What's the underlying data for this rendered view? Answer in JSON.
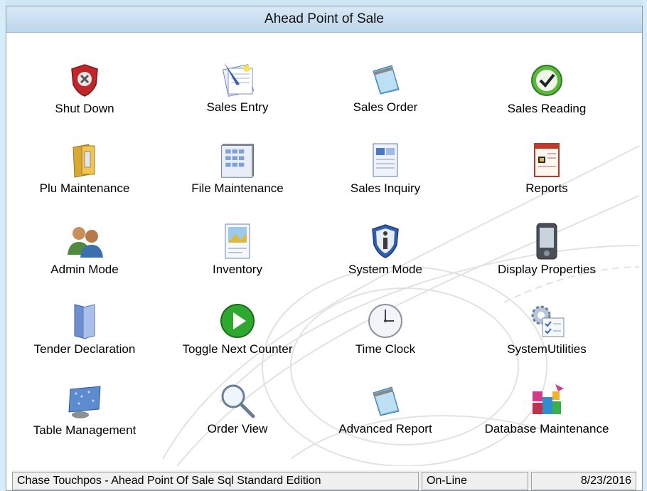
{
  "window": {
    "title": "Ahead Point of Sale"
  },
  "menu": [
    {
      "label": "Shut Down",
      "icon": "shutdown-shield-icon"
    },
    {
      "label": "Sales Entry",
      "icon": "sales-entry-icon"
    },
    {
      "label": "Sales Order",
      "icon": "notepad-icon"
    },
    {
      "label": "Sales Reading",
      "icon": "checkmark-icon"
    },
    {
      "label": "Plu Maintenance",
      "icon": "folder-icon"
    },
    {
      "label": "File Maintenance",
      "icon": "spreadsheet-icon"
    },
    {
      "label": "Sales Inquiry",
      "icon": "document-icon"
    },
    {
      "label": "Reports",
      "icon": "report-icon"
    },
    {
      "label": "Admin Mode",
      "icon": "users-icon"
    },
    {
      "label": "Inventory",
      "icon": "inventory-doc-icon"
    },
    {
      "label": "System Mode",
      "icon": "info-shield-icon"
    },
    {
      "label": "Display Properties",
      "icon": "pda-icon"
    },
    {
      "label": "Tender Declaration",
      "icon": "blue-folder-icon"
    },
    {
      "label": "Toggle Next Counter",
      "icon": "play-icon"
    },
    {
      "label": "Time Clock",
      "icon": "clock-icon"
    },
    {
      "label": "SystemUtilities",
      "icon": "gear-checklist-icon"
    },
    {
      "label": "Table Management",
      "icon": "network-screen-icon"
    },
    {
      "label": "Order View",
      "icon": "magnifier-icon"
    },
    {
      "label": "Advanced Report",
      "icon": "notepad-icon"
    },
    {
      "label": "Database Maintenance",
      "icon": "database-blocks-icon"
    }
  ],
  "status": {
    "edition": "Chase Touchpos - Ahead Point Of Sale Sql Standard Edition",
    "connection": "On-Line",
    "date": "8/23/2016"
  },
  "colors": {
    "titlebar": "#c8ddef",
    "accent_green": "#2fa82f",
    "shield_red": "#c0262a"
  }
}
